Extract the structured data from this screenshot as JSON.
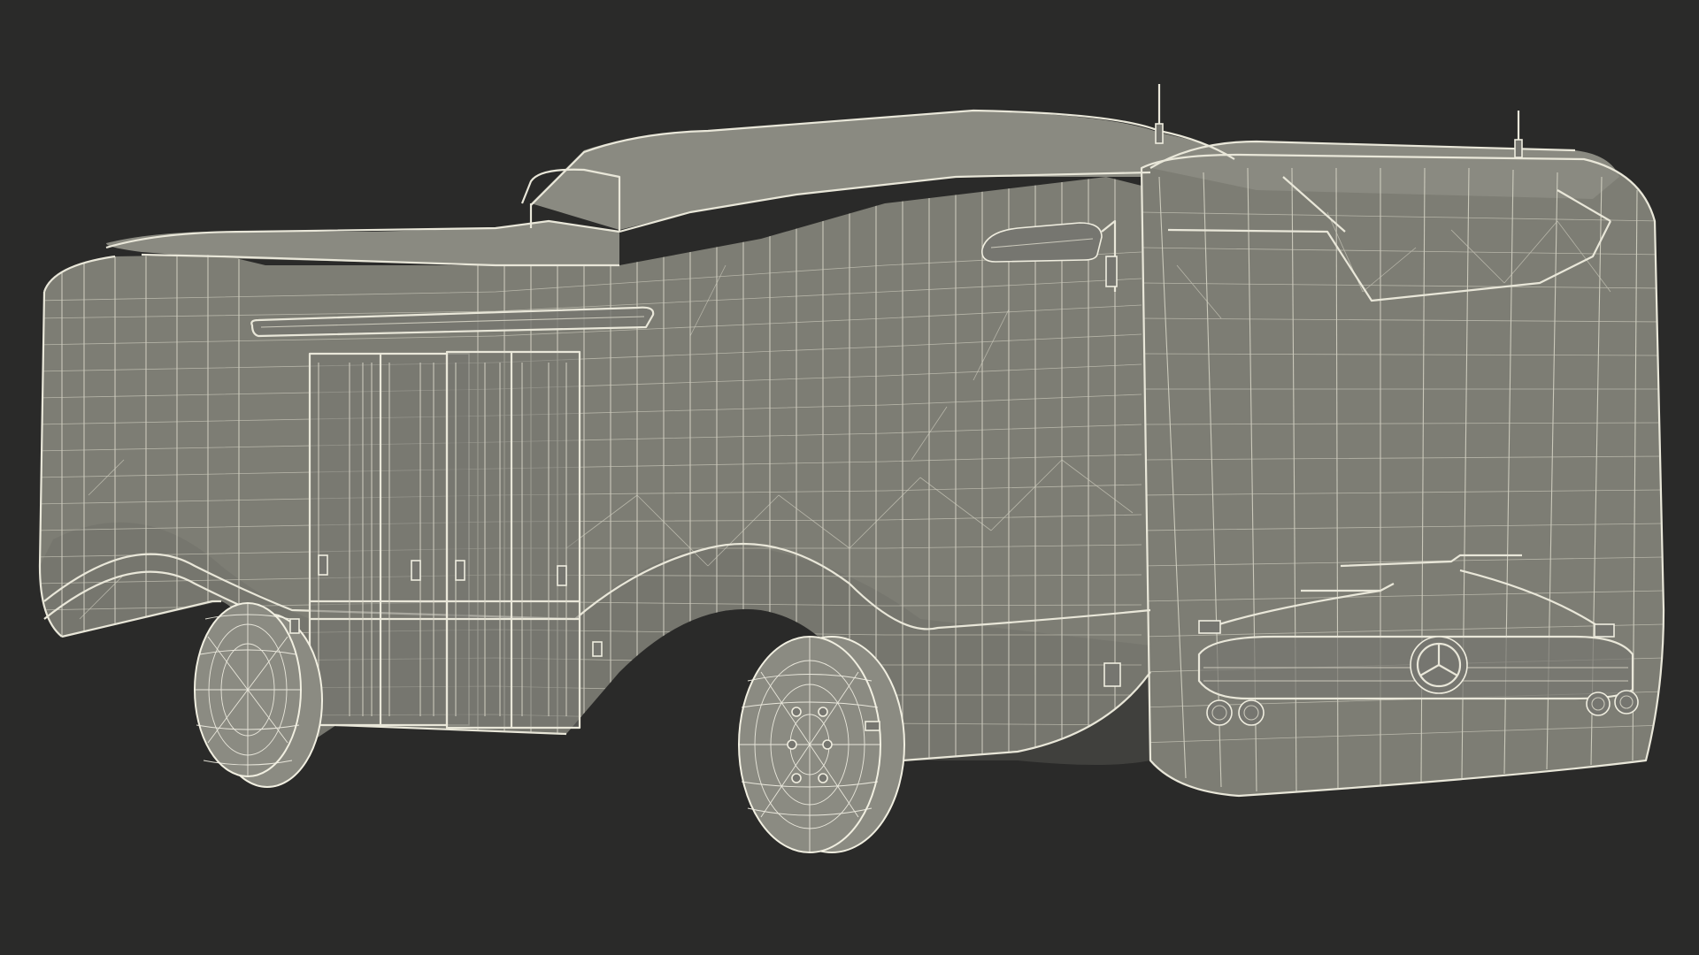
{
  "scene": {
    "subject": "bus-wireframe",
    "colors": {
      "background": "#2a2a29",
      "surface": "#7d7d74",
      "wire": "#e9e7d9"
    }
  }
}
